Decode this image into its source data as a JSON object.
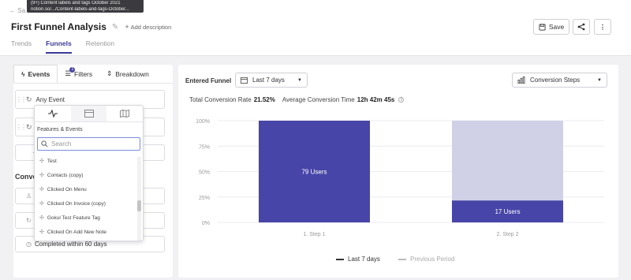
{
  "tooltip": {
    "line1": "(9+) Content labels and tags October 2021",
    "line2": "notion.so/.../Content-labels-and-tags-October..."
  },
  "header": {
    "back_label": "Sa...",
    "title": "First Funnel Analysis",
    "add_description": "Add description",
    "tabs": [
      "Trends",
      "Funnels",
      "Retention"
    ],
    "save_label": "Save"
  },
  "left": {
    "tabs": {
      "events": "Events",
      "filters": "Filters",
      "filters_count": "1",
      "breakdown": "Breakdown"
    },
    "event1": "Any Event",
    "conversion_label": "Conve",
    "completed": "Completed within 60 days",
    "dropdown": {
      "heading": "Features & Events",
      "search_placeholder": "Search",
      "items": [
        "Test",
        "Contacts (copy)",
        "Clicked On Menu",
        "Clicked On Invoice (copy)",
        "Gokul Test Feature Tag",
        "Clicked On Add New Note"
      ]
    }
  },
  "right": {
    "entered_funnel": "Entered Funnel",
    "range": "Last 7 days",
    "view": "Conversion Steps",
    "total_label": "Total Conversion Rate",
    "total_value": "21.52%",
    "avg_label": "Average Conversion Time",
    "avg_value": "12h 42m 45s",
    "legend_current": "Last 7 days",
    "legend_previous": "Previous Period"
  },
  "chart_data": {
    "type": "bar",
    "categories": [
      "1. Step 1",
      "2. Step 2"
    ],
    "series": [
      {
        "name": "Last 7 days",
        "values": [
          100,
          21.52
        ],
        "labels": [
          "79 Users",
          "17 Users"
        ]
      },
      {
        "name": "Previous Period",
        "values": [
          100,
          100
        ]
      }
    ],
    "yticks": [
      "100%",
      "75%",
      "50%",
      "25%",
      "0%"
    ],
    "ylim": [
      0,
      100
    ],
    "colors": {
      "current": "#4845a8",
      "previous": "#d0d0e6"
    }
  }
}
